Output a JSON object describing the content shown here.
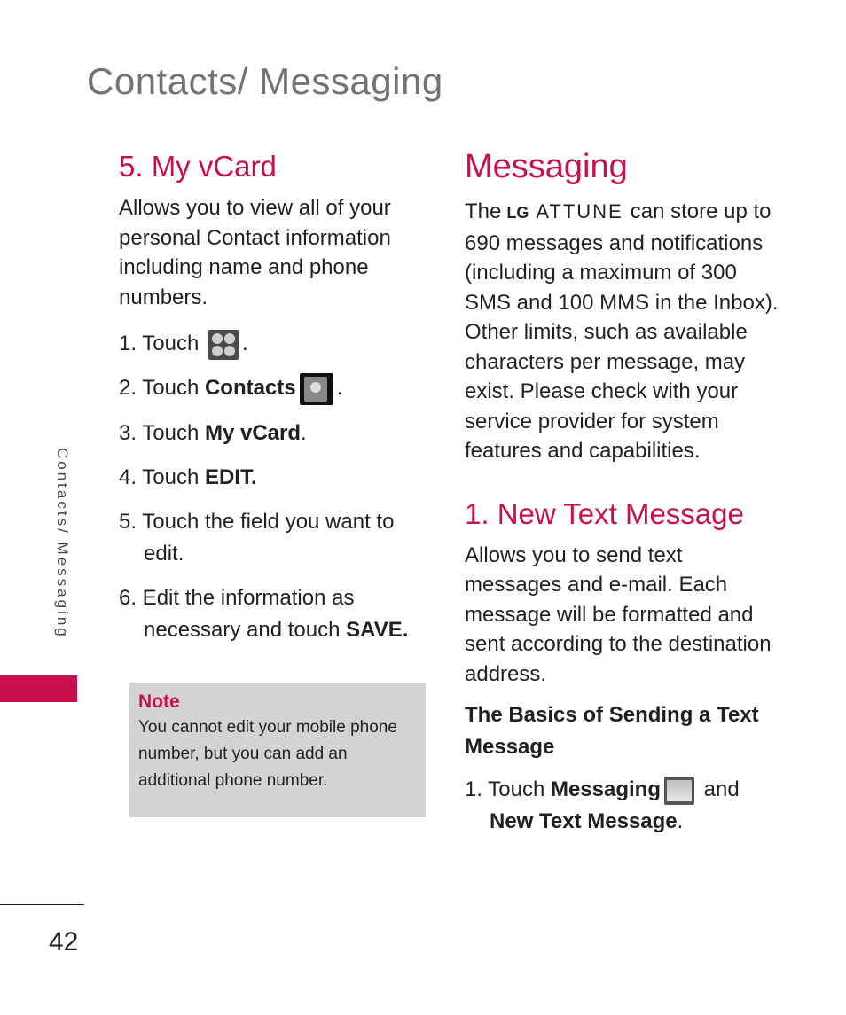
{
  "page": {
    "title": "Contacts/ Messaging",
    "side_tab": "Contacts/ Messaging",
    "page_number": "42",
    "accent_color": "#c8104b"
  },
  "left": {
    "heading": "5. My vCard",
    "intro": "Allows you to view all of your personal Contact information including name and phone numbers.",
    "steps": [
      {
        "pre": "1. Touch ",
        "bold": "",
        "icon": "apps-grid-icon",
        "post": "."
      },
      {
        "pre": "2. Touch ",
        "bold": "Contacts",
        "icon": "contacts-icon",
        "post": "."
      },
      {
        "pre": "3. Touch ",
        "bold": "My vCard",
        "icon": "",
        "post": "."
      },
      {
        "pre": "4. Touch ",
        "bold": "EDIT.",
        "icon": "",
        "post": ""
      },
      {
        "pre": "5. Touch the field you want to edit.",
        "bold": "",
        "icon": "",
        "post": ""
      },
      {
        "pre": "6. Edit the information as necessary and touch ",
        "bold": "SAVE.",
        "icon": "",
        "post": ""
      }
    ],
    "note": {
      "title": "Note",
      "body": "You cannot edit your mobile phone number, but you can add an additional phone number."
    }
  },
  "right": {
    "heading": "Messaging",
    "intro_pre": "The",
    "brand": "LG",
    "model": "ATTUNE",
    "intro_post": "can store up to 690 messages and notifications (including a maximum of 300 SMS and 100 MMS in the Inbox). Other limits, such as available characters per message, may exist. Please check with your service provider for system features and capabilities.",
    "section_heading": "1. New Text Message",
    "section_intro": "Allows you to send text messages and e-mail. Each message will be formatted and sent according to the destination address.",
    "subheading": "The Basics of Sending a Text Message",
    "step1": {
      "pre": "1. Touch ",
      "bold1": "Messaging",
      "icon": "messaging-envelope-icon",
      "mid": " and ",
      "bold2": "New Text Message",
      "post": "."
    }
  }
}
